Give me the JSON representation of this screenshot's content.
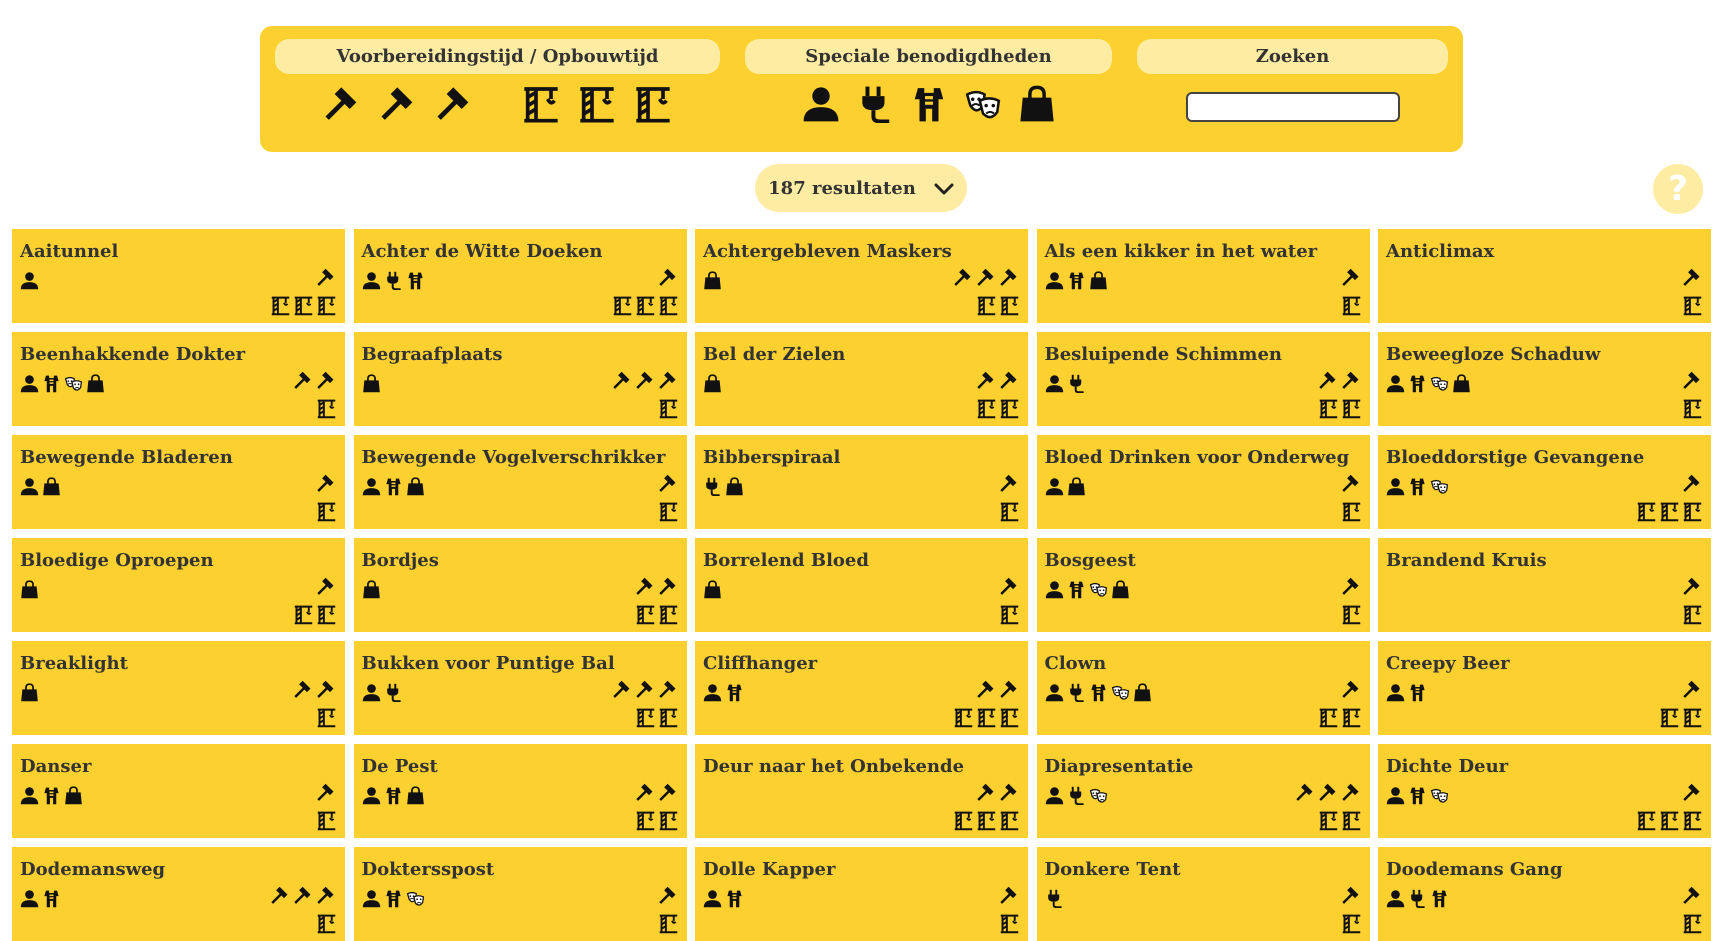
{
  "filters": {
    "prep": {
      "label": "Voorbereidingstijd / Opbouwtijd",
      "hammer_icons": 3,
      "build_icons": 3
    },
    "special": {
      "label": "Speciale benodigdheden",
      "icons": [
        "person-icon",
        "plug-icon",
        "costume-icon",
        "mask-icon",
        "bag-icon"
      ]
    },
    "search": {
      "label": "Zoeken",
      "value": "",
      "placeholder": ""
    }
  },
  "results": {
    "label": "187 resultaten"
  },
  "help": {
    "label": "?"
  },
  "cards": [
    {
      "title": "Aaitunnel",
      "req": [
        "person"
      ],
      "prep": 1,
      "build": 3
    },
    {
      "title": "Achter de Witte Doeken",
      "req": [
        "person",
        "plug",
        "costume"
      ],
      "prep": 1,
      "build": 3
    },
    {
      "title": "Achtergebleven Maskers",
      "req": [
        "bag"
      ],
      "prep": 3,
      "build": 2
    },
    {
      "title": "Als een kikker in het water",
      "req": [
        "person",
        "costume",
        "bag"
      ],
      "prep": 1,
      "build": 1
    },
    {
      "title": "Anticlimax",
      "req": [],
      "prep": 1,
      "build": 1
    },
    {
      "title": "Beenhakkende Dokter",
      "req": [
        "person",
        "costume",
        "mask",
        "bag"
      ],
      "prep": 2,
      "build": 1
    },
    {
      "title": "Begraafplaats",
      "req": [
        "bag"
      ],
      "prep": 3,
      "build": 1
    },
    {
      "title": "Bel der Zielen",
      "req": [
        "bag"
      ],
      "prep": 2,
      "build": 2
    },
    {
      "title": "Besluipende Schimmen",
      "req": [
        "person",
        "plug"
      ],
      "prep": 2,
      "build": 2
    },
    {
      "title": "Beweegloze Schaduw",
      "req": [
        "person",
        "costume",
        "mask",
        "bag"
      ],
      "prep": 1,
      "build": 1
    },
    {
      "title": "Bewegende Bladeren",
      "req": [
        "person",
        "bag"
      ],
      "prep": 1,
      "build": 1
    },
    {
      "title": "Bewegende Vogelverschrikker",
      "req": [
        "person",
        "costume",
        "bag"
      ],
      "prep": 1,
      "build": 1
    },
    {
      "title": "Bibberspiraal",
      "req": [
        "plug",
        "bag"
      ],
      "prep": 1,
      "build": 1
    },
    {
      "title": "Bloed Drinken voor Onderweg",
      "req": [
        "person",
        "bag"
      ],
      "prep": 1,
      "build": 1
    },
    {
      "title": "Bloeddorstige Gevangene",
      "req": [
        "person",
        "costume",
        "mask"
      ],
      "prep": 1,
      "build": 3
    },
    {
      "title": "Bloedige Oproepen",
      "req": [
        "bag"
      ],
      "prep": 1,
      "build": 2
    },
    {
      "title": "Bordjes",
      "req": [
        "bag"
      ],
      "prep": 2,
      "build": 2
    },
    {
      "title": "Borrelend Bloed",
      "req": [
        "bag"
      ],
      "prep": 1,
      "build": 1
    },
    {
      "title": "Bosgeest",
      "req": [
        "person",
        "costume",
        "mask",
        "bag"
      ],
      "prep": 1,
      "build": 1
    },
    {
      "title": "Brandend Kruis",
      "req": [],
      "prep": 1,
      "build": 1
    },
    {
      "title": "Breaklight",
      "req": [
        "bag"
      ],
      "prep": 2,
      "build": 1
    },
    {
      "title": "Bukken voor Puntige Bal",
      "req": [
        "person",
        "plug"
      ],
      "prep": 3,
      "build": 2
    },
    {
      "title": "Cliffhanger",
      "req": [
        "person",
        "costume"
      ],
      "prep": 2,
      "build": 3
    },
    {
      "title": "Clown",
      "req": [
        "person",
        "plug",
        "costume",
        "mask",
        "bag"
      ],
      "prep": 1,
      "build": 2
    },
    {
      "title": "Creepy Beer",
      "req": [
        "person",
        "costume"
      ],
      "prep": 1,
      "build": 2
    },
    {
      "title": "Danser",
      "req": [
        "person",
        "costume",
        "bag"
      ],
      "prep": 1,
      "build": 1
    },
    {
      "title": "De Pest",
      "req": [
        "person",
        "costume",
        "bag"
      ],
      "prep": 2,
      "build": 2
    },
    {
      "title": "Deur naar het Onbekende",
      "req": [],
      "prep": 2,
      "build": 3
    },
    {
      "title": "Diapresentatie",
      "req": [
        "person",
        "plug",
        "mask"
      ],
      "prep": 3,
      "build": 2
    },
    {
      "title": "Dichte Deur",
      "req": [
        "person",
        "costume",
        "mask"
      ],
      "prep": 1,
      "build": 3
    },
    {
      "title": "Dodemansweg",
      "req": [
        "person",
        "costume"
      ],
      "prep": 3,
      "build": 1
    },
    {
      "title": "Doktersspost",
      "req": [
        "person",
        "costume",
        "mask"
      ],
      "prep": 1,
      "build": 1
    },
    {
      "title": "Dolle Kapper",
      "req": [
        "person",
        "costume"
      ],
      "prep": 1,
      "build": 1
    },
    {
      "title": "Donkere Tent",
      "req": [
        "plug"
      ],
      "prep": 1,
      "build": 1
    },
    {
      "title": "Doodemans Gang",
      "req": [
        "person",
        "plug",
        "costume"
      ],
      "prep": 1,
      "build": 1
    }
  ]
}
